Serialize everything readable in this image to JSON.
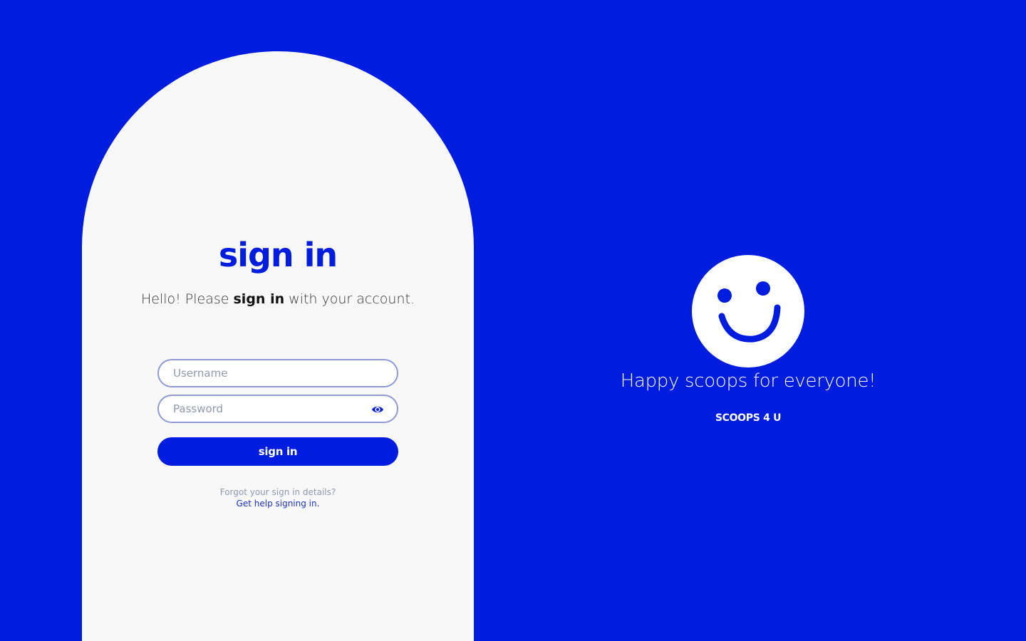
{
  "colors": {
    "brand_blue": "#001cdf",
    "card_bg": "#f8f8f8",
    "input_border": "#8f99d6",
    "muted_text": "#8f99ae",
    "link": "#1a33c8"
  },
  "signin": {
    "title": "sign in",
    "subtitle_before": "Hello! Please ",
    "subtitle_bold": "sign in",
    "subtitle_after": " with your account.",
    "username_placeholder": "Username",
    "password_placeholder": "Password",
    "show_password_icon": "eye-icon",
    "submit_label": "sign in",
    "forgot_text": "Forgot your sign in details?",
    "help_link": "Get help signing in."
  },
  "promo": {
    "logo_icon": "smiley-face-icon",
    "tagline": "Happy scoops for everyone!",
    "brand_name": "SCOOPS 4 U"
  }
}
